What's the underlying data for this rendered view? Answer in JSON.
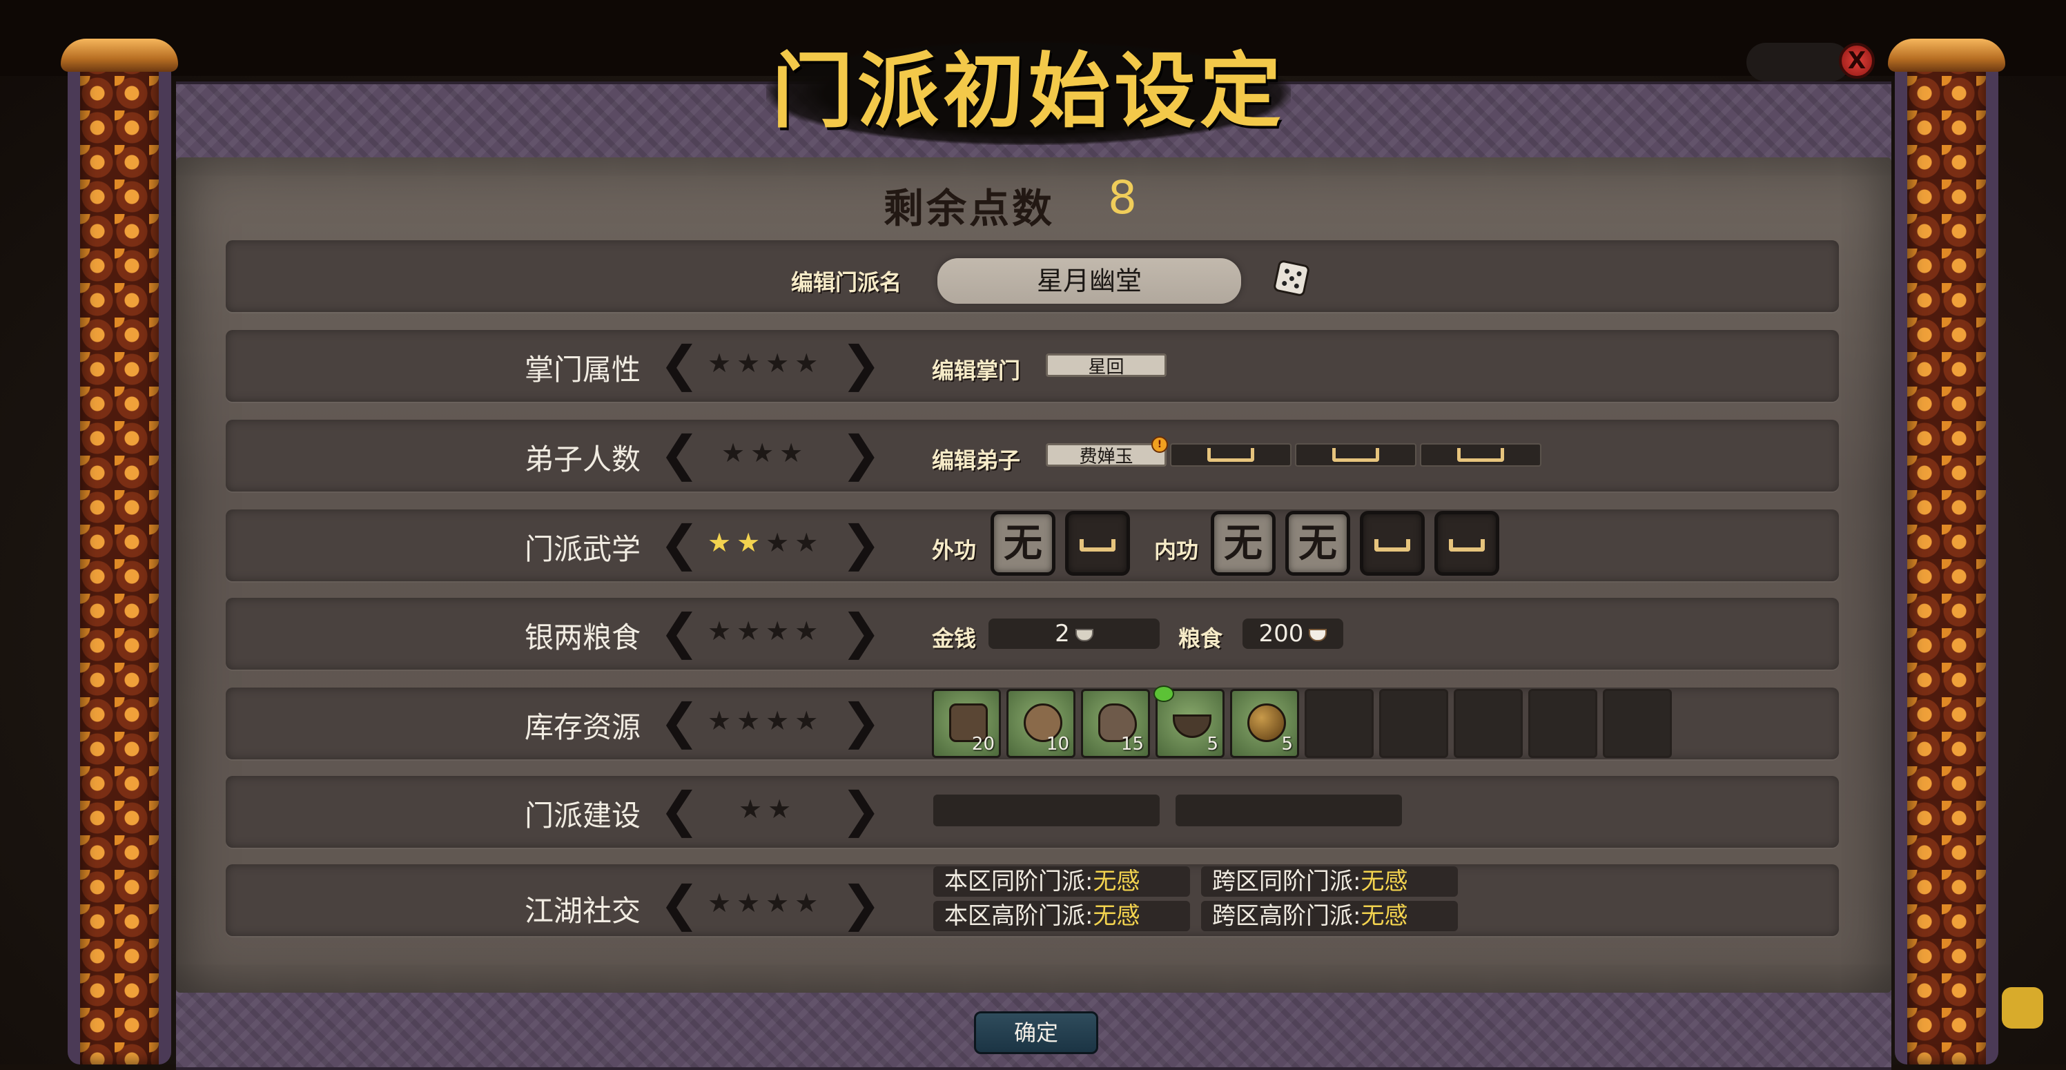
{
  "title": "门派初始设定",
  "remaining_points": {
    "label": "剩余点数",
    "value": "8"
  },
  "sect_name": {
    "label": "编辑门派名",
    "value": "星月幽堂",
    "icon": "dice-icon"
  },
  "rows": [
    {
      "label": "掌门属性",
      "stars_total": 4,
      "stars_filled": 0
    },
    {
      "label": "弟子人数",
      "stars_total": 3,
      "stars_filled": 0
    },
    {
      "label": "门派武学",
      "stars_total": 4,
      "stars_filled": 2
    },
    {
      "label": "银两粮食",
      "stars_total": 4,
      "stars_filled": 0
    },
    {
      "label": "库存资源",
      "stars_total": 4,
      "stars_filled": 0
    },
    {
      "label": "门派建设",
      "stars_total": 2,
      "stars_filled": 0
    },
    {
      "label": "江湖社交",
      "stars_total": 4,
      "stars_filled": 0
    }
  ],
  "leader": {
    "label": "编辑掌门",
    "name": "星回"
  },
  "disciples": {
    "label": "编辑弟子",
    "names": [
      "费婵玉"
    ],
    "empty_slots": 3
  },
  "martial": {
    "outer_label": "外功",
    "inner_label": "内功",
    "outer_slots": [
      "无",
      ""
    ],
    "inner_slots": [
      "无",
      "无",
      "",
      ""
    ]
  },
  "money": {
    "label": "金钱",
    "value": "2",
    "icon": "coin-icon"
  },
  "food": {
    "label": "粮食",
    "value": "200",
    "icon": "rice-icon"
  },
  "resources": {
    "items": [
      {
        "icon": "wood-planks-icon",
        "qty": "20"
      },
      {
        "icon": "log-icon",
        "qty": "10"
      },
      {
        "icon": "ore-icon",
        "qty": "15"
      },
      {
        "icon": "herb-bowl-icon",
        "qty": "5"
      },
      {
        "icon": "metal-ball-icon",
        "qty": "5"
      }
    ],
    "empty_slots": 5
  },
  "buildings": {
    "slots": 2
  },
  "social": [
    {
      "label": "本区同阶门派:",
      "value": "无感"
    },
    {
      "label": "跨区同阶门派:",
      "value": "无感"
    },
    {
      "label": "本区高阶门派:",
      "value": "无感"
    },
    {
      "label": "跨区高阶门派:",
      "value": "无感"
    }
  ],
  "confirm_label": "确定",
  "close_label": "X",
  "colors": {
    "accent": "#f3d34f",
    "title": "#f3c94a",
    "row_bg": "#4a423f"
  }
}
